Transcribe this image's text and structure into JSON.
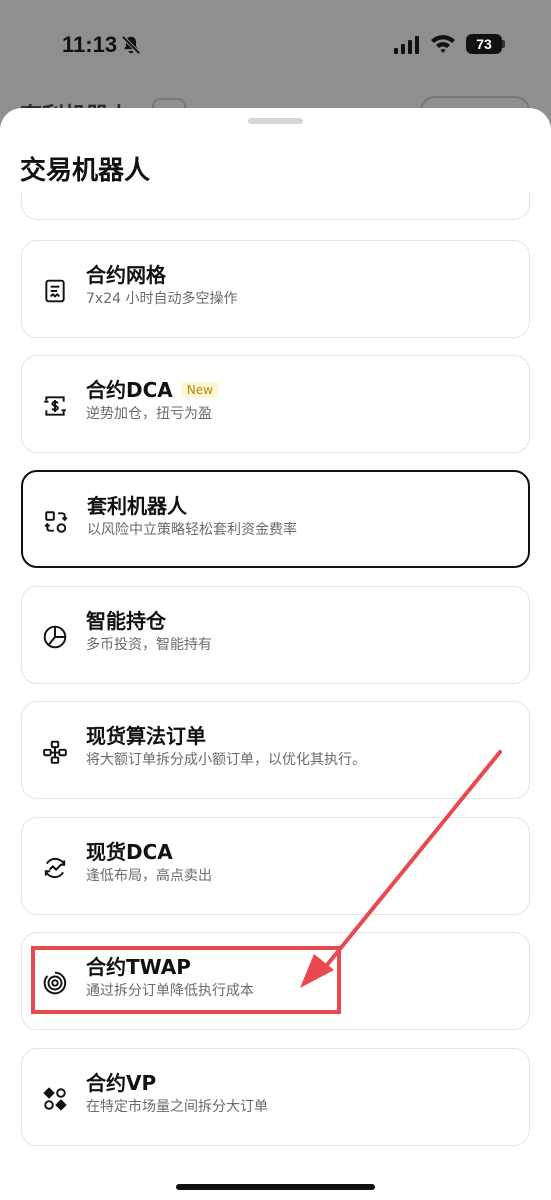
{
  "status_bar": {
    "time": "11:13",
    "battery": "73",
    "icons": [
      "bell-muted-icon",
      "signal-icon",
      "wifi-icon",
      "battery-icon"
    ]
  },
  "background": {
    "title": "套利机器人"
  },
  "sheet": {
    "title": "交易机器人",
    "items": [
      {
        "title": "合约网格",
        "subtitle": "7x24 小时自动多空操作",
        "icon": "grid-document-icon",
        "selected": false
      },
      {
        "title": "合约DCA",
        "badge": "New",
        "subtitle": "逆势加仓，扭亏为盈",
        "icon": "dollar-cycle-icon",
        "selected": false
      },
      {
        "title": "套利机器人",
        "subtitle": "以风险中立策略轻松套利资金费率",
        "icon": "arbitrage-icon",
        "selected": true
      },
      {
        "title": "智能持仓",
        "subtitle": "多币投资，智能持有",
        "icon": "pie-chart-icon",
        "selected": false
      },
      {
        "title": "现货算法订单",
        "subtitle": "将大额订单拆分成小额订单，以优化其执行。",
        "icon": "algo-split-icon",
        "selected": false
      },
      {
        "title": "现货DCA",
        "subtitle": "逢低布局，高点卖出",
        "icon": "cycle-chart-icon",
        "selected": false
      },
      {
        "title": "合约TWAP",
        "subtitle": "通过拆分订单降低执行成本",
        "icon": "twap-icon",
        "selected": false
      },
      {
        "title": "合约VP",
        "subtitle": "在特定市场量之间拆分大订单",
        "icon": "vp-icon",
        "selected": false
      }
    ]
  },
  "annotation": {
    "highlight_color": "#e9484e"
  }
}
